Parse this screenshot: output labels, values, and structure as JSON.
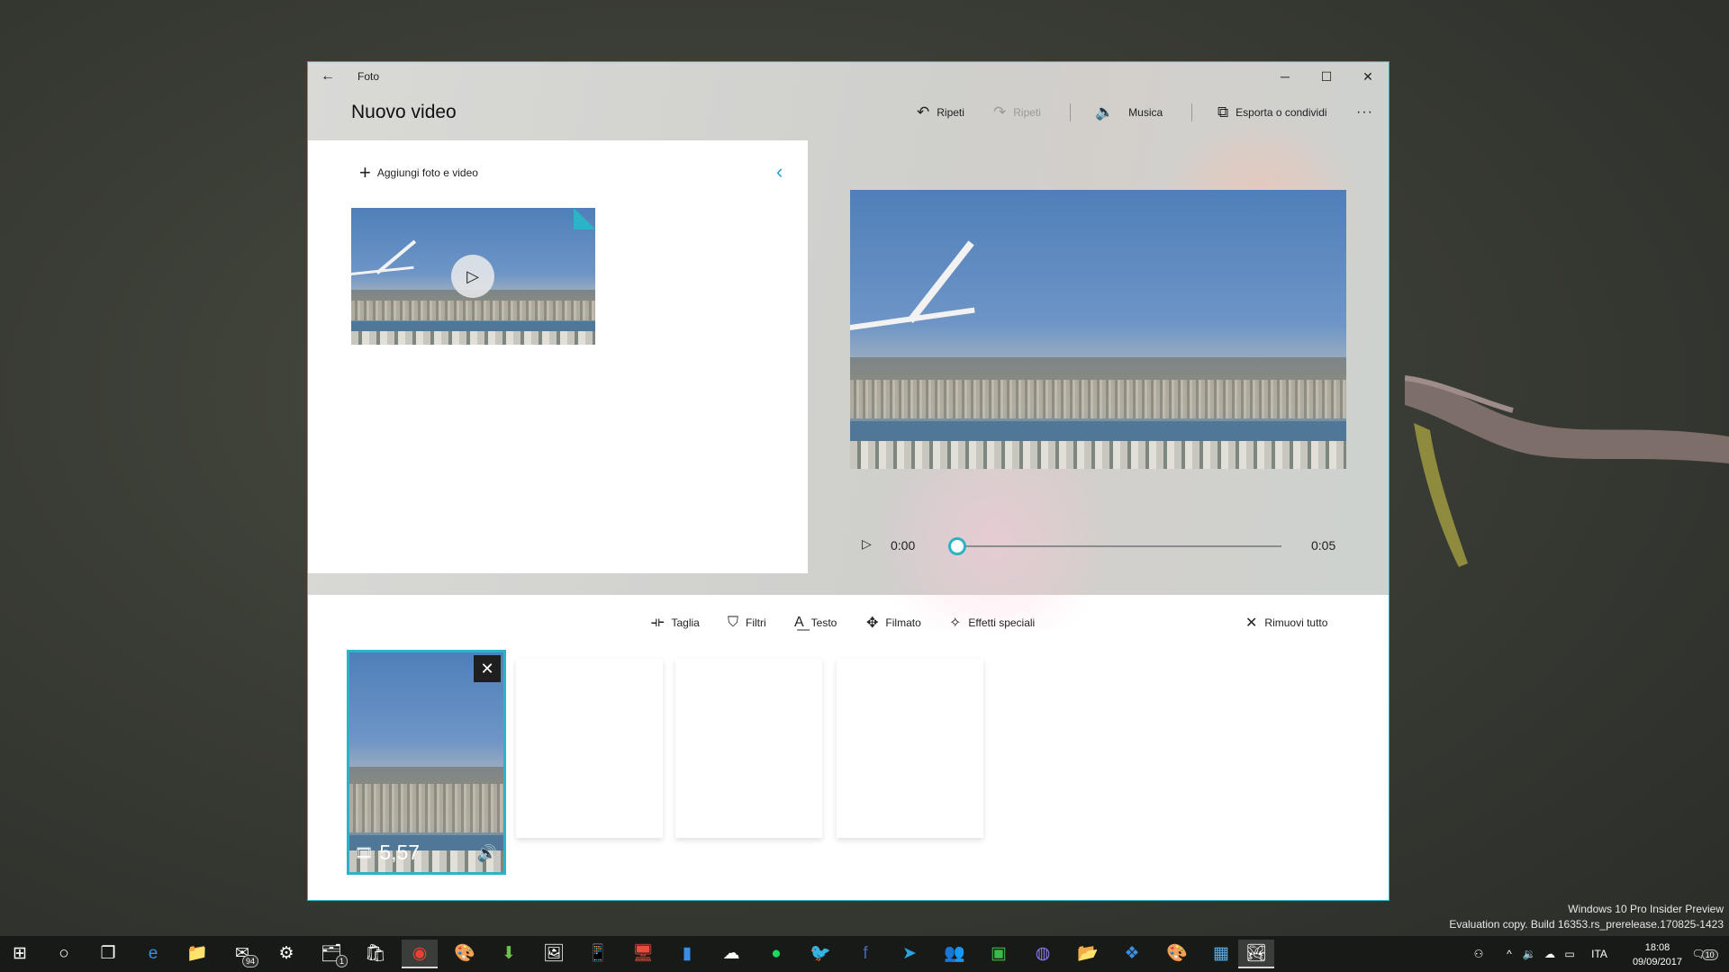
{
  "window": {
    "app_title": "Foto",
    "page_title": "Nuovo video",
    "controls": {
      "minimize": "─",
      "maximize": "☐",
      "close": "✕"
    }
  },
  "commands": {
    "undo": {
      "icon": "undo-icon",
      "label": "Ripeti"
    },
    "redo": {
      "icon": "redo-icon",
      "label": "Ripeti"
    },
    "music": {
      "icon": "speaker-icon",
      "label": "Musica"
    },
    "export": {
      "icon": "export-share-icon",
      "label": "Esporta o condividi"
    },
    "more": "···"
  },
  "library": {
    "add_label": "Aggiungi foto e video",
    "collapse_icon": "chevron-left-icon",
    "items": [
      {
        "type": "video",
        "thumbnail": "airplane-wing-over-city"
      }
    ]
  },
  "player": {
    "current_time": "0:00",
    "total_time": "0:05",
    "progress": 0.0
  },
  "storyboard_tools": {
    "trim": "Taglia",
    "filters": "Filtri",
    "text": "Testo",
    "motion": "Filmato",
    "effects": "Effetti speciali",
    "remove_all": "Rimuovi tutto"
  },
  "storyboard": {
    "cards": [
      {
        "duration": "5,57",
        "selected": true
      },
      {
        "empty": true
      },
      {
        "empty": true
      },
      {
        "empty": true
      }
    ]
  },
  "desktop": {
    "watermark_line1": "Windows 10 Pro Insider Preview",
    "watermark_line2": "Evaluation copy. Build 16353.rs_prerelease.170825-1423"
  },
  "taskbar": {
    "mail_badge": "94",
    "explorer_badge": "1",
    "language": "ITA",
    "time": "18:08",
    "date": "09/09/2017",
    "notifications_badge": "10"
  },
  "colors": {
    "accent": "#2bb3c6",
    "chevron": "#2b9fc6"
  }
}
